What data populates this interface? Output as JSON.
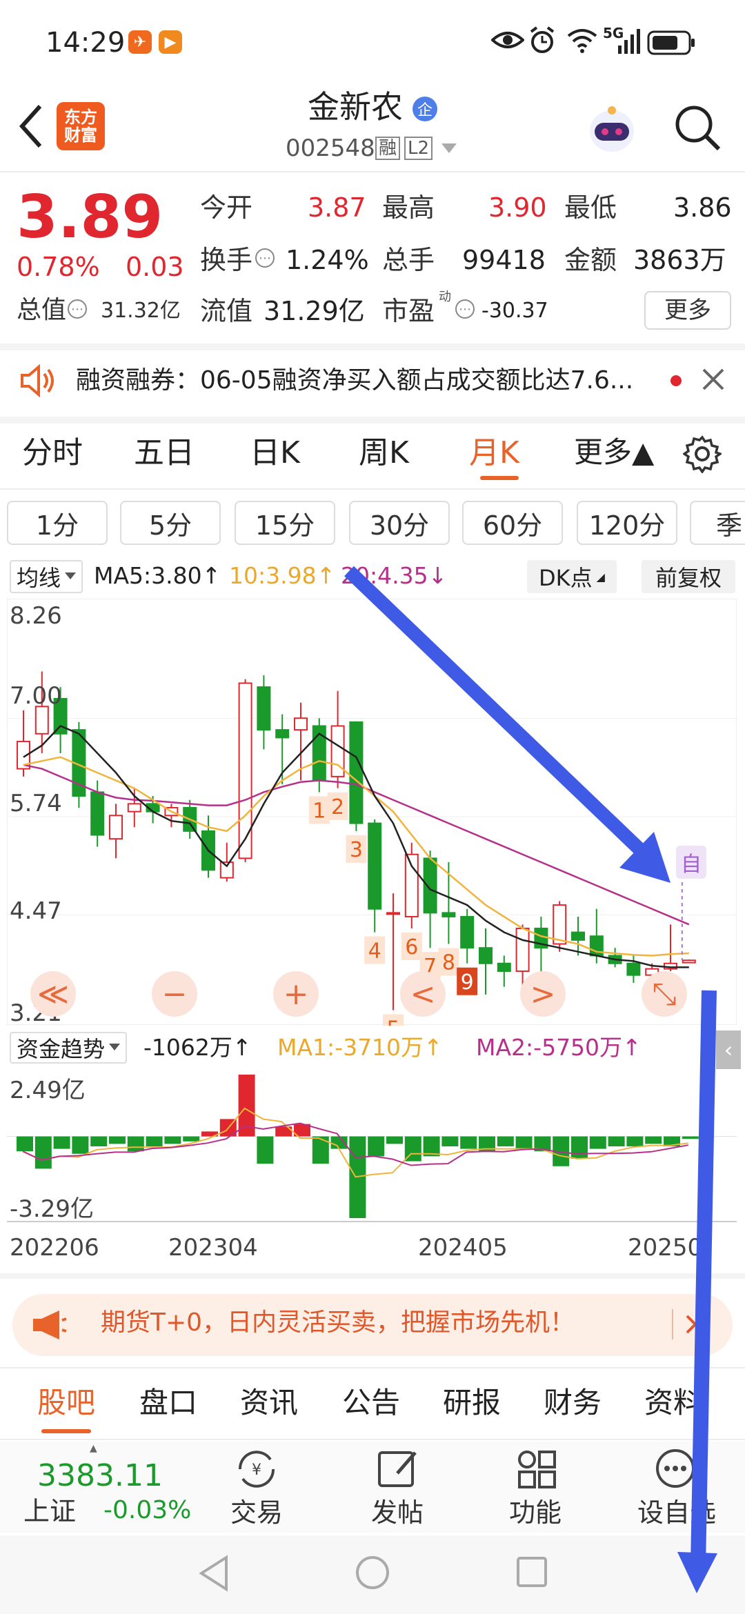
{
  "status_bar": {
    "time": "14:29",
    "network": "5G"
  },
  "header": {
    "stock_name": "金新农",
    "badge": "企",
    "code": "002548",
    "tag_rong": "融",
    "tag_level": "L2",
    "logo_line1": "东方",
    "logo_line2": "财富"
  },
  "quote": {
    "price": "3.89",
    "change_pct": "0.78%",
    "change_abs": "0.03",
    "open_label": "今开",
    "open": "3.87",
    "high_label": "最高",
    "high": "3.90",
    "low_label": "最低",
    "low": "3.86",
    "turnover_label": "换手",
    "turnover": "1.24%",
    "volume_label": "总手",
    "volume": "99418",
    "amount_label": "金额",
    "amount": "3863万",
    "mktcap_label": "总值",
    "mktcap": "31.32亿",
    "float_label": "流值",
    "float_cap": "31.29亿",
    "pe_label": "市盈",
    "pe_sup": "动",
    "pe": "-30.37",
    "more_button": "更多"
  },
  "notice": {
    "text": "融资融券：06-05融资净买入额占成交额比达7.6..."
  },
  "period_tabs": [
    "分时",
    "五日",
    "日K",
    "周K",
    "月K",
    "更多▲"
  ],
  "active_tab": "月K",
  "minute_pills": [
    "1分",
    "5分",
    "15分",
    "30分",
    "60分",
    "120分",
    "季"
  ],
  "ma_bar": {
    "selector": "均线",
    "ma5": "MA5:3.80↑",
    "ma10": "10:3.98↑",
    "ma20": "20:4.35↓",
    "dk": "DK点",
    "adjust": "前复权"
  },
  "price_axis": [
    "8.26",
    "7.00",
    "5.74",
    "4.47",
    "3.21"
  ],
  "signal_label": "自",
  "chart_controls": [
    "≪",
    "−",
    "+",
    "<",
    ">",
    "⤡"
  ],
  "capital": {
    "selector": "资金趋势",
    "value": "-1062万↑",
    "ma1": "MA1:-3710万↑",
    "ma2": "MA2:-5750万↑",
    "top": "2.49亿",
    "bottom": "-3.29亿"
  },
  "date_axis": [
    "202206",
    "202304",
    "202405",
    "20250"
  ],
  "ad": {
    "text": "期货T+0，日内灵活买卖，把握市场先机！"
  },
  "section_tabs": [
    "股吧",
    "盘口",
    "资讯",
    "公告",
    "研报",
    "财务",
    "资料"
  ],
  "bottom_nav": {
    "index_value": "3383.11",
    "index_name": "上证",
    "index_change": "-0.03%",
    "trade": "交易",
    "post": "发帖",
    "func": "功能",
    "settings": "设自选"
  },
  "colors": {
    "up": "#e0262e",
    "down": "#1a9a2a",
    "accent": "#e8632a",
    "ma5": "#222222",
    "ma10": "#f0b43c",
    "ma20": "#b5308a",
    "arrow": "#3f5be6"
  },
  "chart_data": {
    "type": "candlestick",
    "ylim": [
      3.21,
      8.26
    ],
    "candles": [
      {
        "o": 6.35,
        "c": 6.7,
        "h": 7.1,
        "l": 6.25
      },
      {
        "o": 6.8,
        "c": 7.15,
        "h": 7.6,
        "l": 6.55
      },
      {
        "o": 7.25,
        "c": 6.8,
        "h": 7.4,
        "l": 6.55
      },
      {
        "o": 6.85,
        "c": 6.0,
        "h": 6.95,
        "l": 5.85
      },
      {
        "o": 6.05,
        "c": 5.5,
        "h": 6.2,
        "l": 5.35
      },
      {
        "o": 5.45,
        "c": 5.75,
        "h": 5.9,
        "l": 5.2
      },
      {
        "o": 5.8,
        "c": 5.9,
        "h": 6.1,
        "l": 5.6
      },
      {
        "o": 5.9,
        "c": 5.8,
        "h": 6.0,
        "l": 5.65
      },
      {
        "o": 5.75,
        "c": 5.85,
        "h": 5.9,
        "l": 5.6
      },
      {
        "o": 5.85,
        "c": 5.55,
        "h": 5.95,
        "l": 5.45
      },
      {
        "o": 5.55,
        "c": 5.05,
        "h": 5.75,
        "l": 4.95
      },
      {
        "o": 4.95,
        "c": 5.15,
        "h": 5.4,
        "l": 4.9
      },
      {
        "o": 5.2,
        "c": 7.45,
        "h": 7.5,
        "l": 5.15
      },
      {
        "o": 7.4,
        "c": 6.85,
        "h": 7.55,
        "l": 6.6
      },
      {
        "o": 6.85,
        "c": 6.75,
        "h": 7.05,
        "l": 6.15
      },
      {
        "o": 6.85,
        "c": 7.0,
        "h": 7.2,
        "l": 6.2
      },
      {
        "o": 6.9,
        "c": 6.2,
        "h": 7.0,
        "l": 6.05
      },
      {
        "o": 6.25,
        "c": 6.9,
        "h": 7.35,
        "l": 6.1
      },
      {
        "o": 6.95,
        "c": 5.65,
        "h": 6.95,
        "l": 5.55
      },
      {
        "o": 5.65,
        "c": 4.55,
        "h": 5.7,
        "l": 4.25
      },
      {
        "o": 4.5,
        "c": 4.5,
        "h": 4.75,
        "l": 3.25
      },
      {
        "o": 4.45,
        "c": 5.25,
        "h": 5.4,
        "l": 4.3
      },
      {
        "o": 5.2,
        "c": 4.5,
        "h": 5.3,
        "l": 4.05
      },
      {
        "o": 4.5,
        "c": 4.45,
        "h": 5.15,
        "l": 4.1
      },
      {
        "o": 4.45,
        "c": 4.05,
        "h": 4.55,
        "l": 3.85
      },
      {
        "o": 4.05,
        "c": 3.85,
        "h": 4.3,
        "l": 3.45
      },
      {
        "o": 3.85,
        "c": 3.75,
        "h": 3.95,
        "l": 3.55
      },
      {
        "o": 3.75,
        "c": 4.3,
        "h": 4.35,
        "l": 3.55
      },
      {
        "o": 4.3,
        "c": 4.05,
        "h": 4.45,
        "l": 3.7
      },
      {
        "o": 4.1,
        "c": 4.6,
        "h": 4.65,
        "l": 4.0
      },
      {
        "o": 4.25,
        "c": 4.15,
        "h": 4.45,
        "l": 3.95
      },
      {
        "o": 4.2,
        "c": 3.95,
        "h": 4.55,
        "l": 3.85
      },
      {
        "o": 3.95,
        "c": 3.85,
        "h": 4.05,
        "l": 3.8
      },
      {
        "o": 3.85,
        "c": 3.7,
        "h": 3.95,
        "l": 3.6
      },
      {
        "o": 3.7,
        "c": 3.78,
        "h": 3.85,
        "l": 3.62
      },
      {
        "o": 3.78,
        "c": 3.85,
        "h": 4.35,
        "l": 3.75
      },
      {
        "o": 3.86,
        "c": 3.89,
        "h": 3.9,
        "l": 3.86
      }
    ],
    "ma5": [
      6.5,
      6.65,
      6.9,
      6.8,
      6.55,
      6.3,
      6.0,
      5.8,
      5.68,
      5.65,
      5.3,
      5.1,
      5.45,
      5.9,
      6.3,
      6.55,
      6.8,
      6.65,
      6.5,
      6.0,
      5.65,
      5.1,
      4.8,
      4.7,
      4.6,
      4.4,
      4.25,
      4.15,
      4.1,
      4.05,
      4.0,
      3.95,
      3.9,
      3.88,
      3.82,
      3.8,
      3.8
    ],
    "ma10": [
      6.4,
      6.45,
      6.5,
      6.4,
      6.3,
      6.2,
      6.1,
      5.95,
      5.8,
      5.7,
      5.6,
      5.55,
      5.75,
      6.0,
      6.2,
      6.35,
      6.45,
      6.4,
      6.2,
      6.0,
      5.8,
      5.5,
      5.2,
      5.0,
      4.8,
      4.6,
      4.45,
      4.3,
      4.2,
      4.15,
      4.1,
      4.0,
      3.98,
      3.96,
      3.95,
      3.97,
      3.98
    ],
    "ma20": [
      6.4,
      6.35,
      6.25,
      6.15,
      6.05,
      5.98,
      5.95,
      5.94,
      5.92,
      5.9,
      5.88,
      5.88,
      5.95,
      6.05,
      6.12,
      6.18,
      6.2,
      6.18,
      6.15,
      6.05,
      5.95,
      5.85,
      5.75,
      5.65,
      5.55,
      5.45,
      5.35,
      5.25,
      5.15,
      5.05,
      4.95,
      4.85,
      4.75,
      4.65,
      4.55,
      4.45,
      4.35
    ],
    "markers": [
      {
        "i": 16,
        "label": "1"
      },
      {
        "i": 17,
        "label": "2"
      },
      {
        "i": 18,
        "label": "3"
      },
      {
        "i": 19,
        "label": "4"
      },
      {
        "i": 20,
        "label": "5"
      },
      {
        "i": 21,
        "label": "6"
      },
      {
        "i": 22,
        "label": "7"
      },
      {
        "i": 23,
        "label": "8"
      },
      {
        "i": 24,
        "label": "9"
      }
    ],
    "capital_flow": [
      -0.6,
      -1.3,
      -0.5,
      -0.7,
      -0.4,
      -0.3,
      -0.6,
      -0.4,
      -0.3,
      -0.2,
      0.2,
      0.7,
      2.49,
      -1.1,
      0.4,
      0.5,
      -1.1,
      -0.5,
      -3.29,
      -0.8,
      -0.3,
      -1.0,
      -0.8,
      -0.4,
      -0.5,
      -0.6,
      -0.4,
      -0.5,
      -0.6,
      -1.2,
      -0.9,
      -0.5,
      -0.4,
      -0.4,
      -0.3,
      -0.4,
      -0.1
    ],
    "capital_ylim": [
      -3.29,
      2.49
    ]
  }
}
